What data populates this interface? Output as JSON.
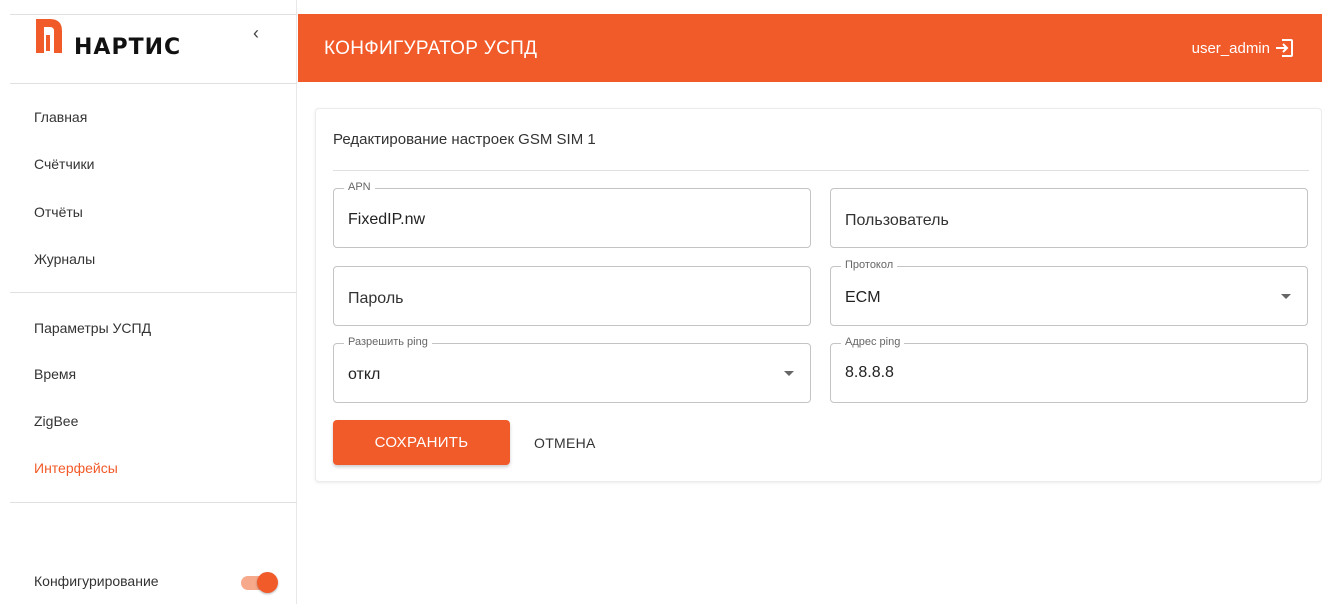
{
  "brand": {
    "name": "НАРТИС"
  },
  "colors": {
    "accent": "#f15a29",
    "accent_light": "#f7a98b"
  },
  "sidebar": {
    "items": [
      {
        "label": "Главная"
      },
      {
        "label": "Счётчики"
      },
      {
        "label": "Отчёты"
      },
      {
        "label": "Журналы"
      },
      {
        "label": "Параметры УСПД"
      },
      {
        "label": "Время"
      },
      {
        "label": "ZigBee"
      },
      {
        "label": "Интерфейсы",
        "active": true
      }
    ],
    "config_toggle": {
      "label": "Конфигурирование",
      "on": true
    }
  },
  "header": {
    "title": "КОНФИГУРАТОР УСПД",
    "user": "user_admin",
    "logout_icon": "logout-icon"
  },
  "form": {
    "title": "Редактирование настроек GSM SIM 1",
    "apn": {
      "label": "APN",
      "value": "FixedIP.nw"
    },
    "user": {
      "placeholder": "Пользователь"
    },
    "password": {
      "placeholder": "Пароль"
    },
    "protocol": {
      "label": "Протокол",
      "value": "ECM"
    },
    "allow_ping": {
      "label": "Разрешить ping",
      "value": "откл"
    },
    "ping_address": {
      "label": "Адрес ping",
      "value": "8.8.8.8"
    },
    "save_label": "СОХРАНИТЬ",
    "cancel_label": "ОТМЕНА"
  }
}
